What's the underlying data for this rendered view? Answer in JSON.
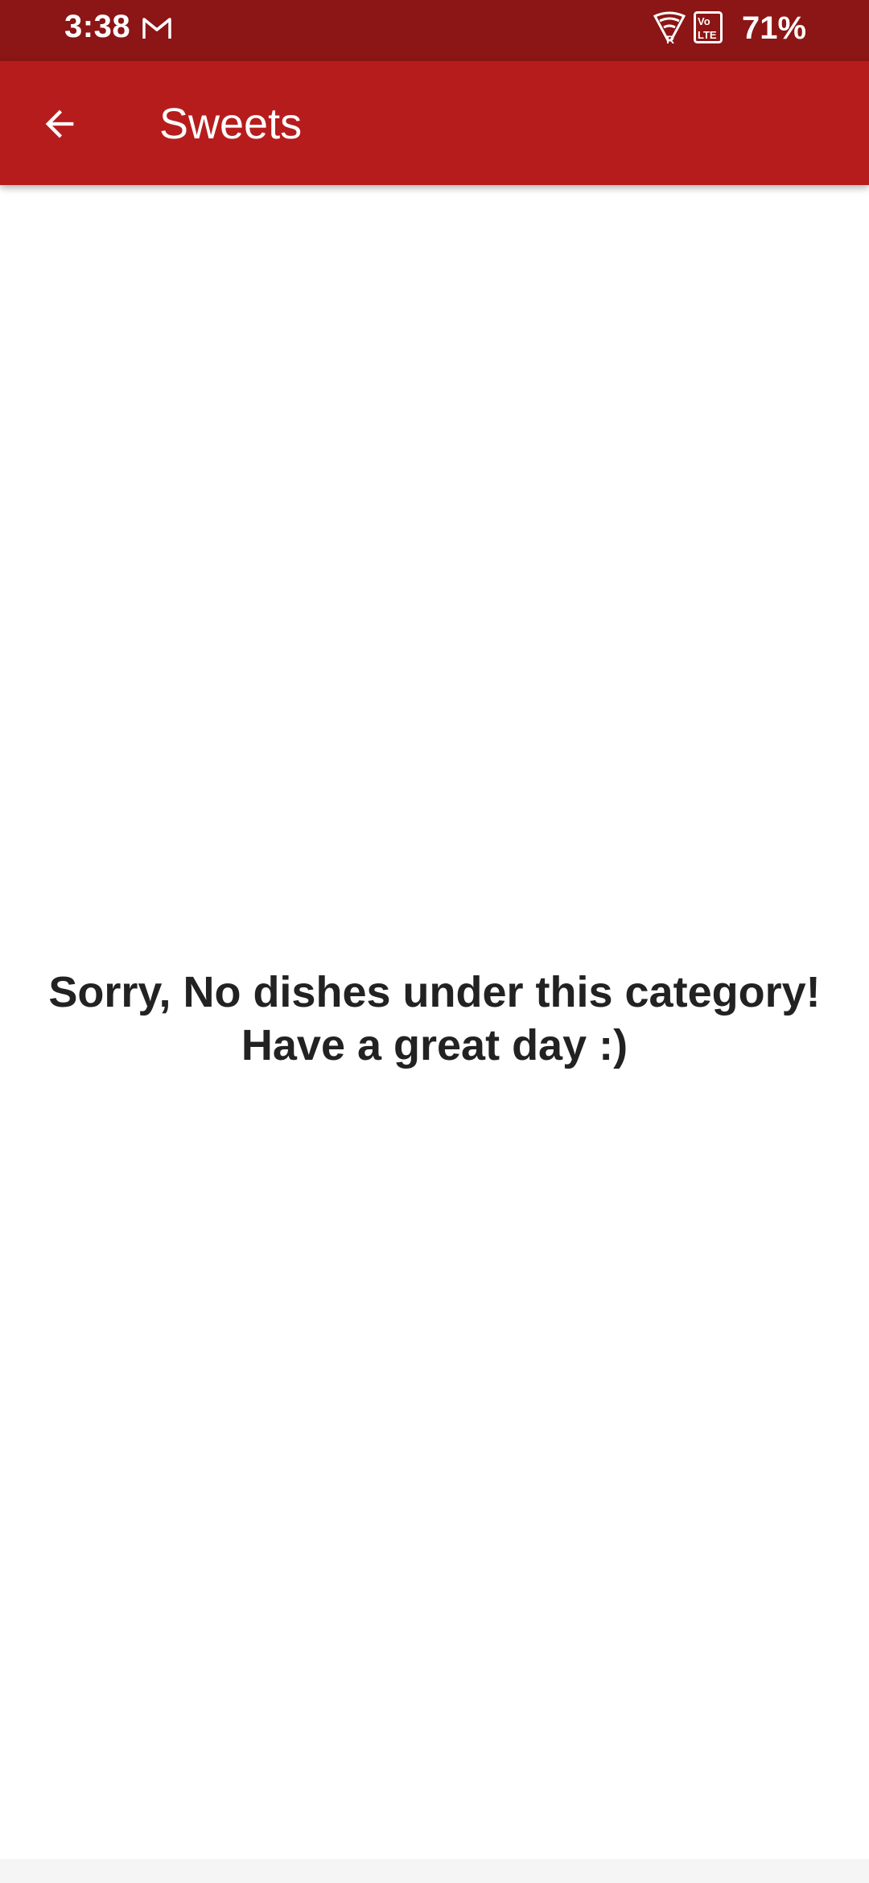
{
  "status_bar": {
    "time": "3:38",
    "battery": "71%",
    "icons": [
      "gmail-icon",
      "wifi-icon",
      "volte-icon"
    ],
    "background_color": "#8c1515"
  },
  "app_bar": {
    "title": "Sweets",
    "back_icon": "arrow-back-icon",
    "background_color": "#b71c1c"
  },
  "content": {
    "empty_message_line1": "Sorry, No dishes under this category!",
    "empty_message_line2": "Have a great day :)"
  }
}
